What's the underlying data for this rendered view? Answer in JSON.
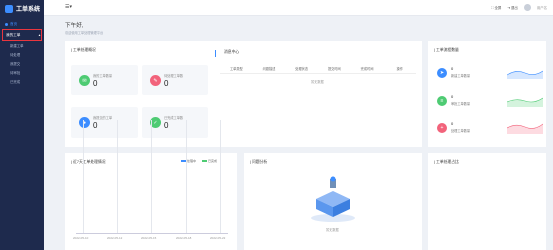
{
  "sidebar": {
    "app_title": "工单系统",
    "home": "首页",
    "group": "我的工单",
    "items": [
      "新建工单",
      "待处理",
      "我提交",
      "待审批",
      "已完成"
    ]
  },
  "topbar": {
    "menu_icon": "menu-icon",
    "fullscreen": "全屏",
    "logout": "退出",
    "user": "用户名"
  },
  "greeting": {
    "title": "下午好,",
    "subtitle": "欢迎使用工单处理管理平台"
  },
  "overview": {
    "title": "工单处理概况",
    "stats": [
      {
        "label": "我的工单数量",
        "value": "0",
        "color": "#4ecb73"
      },
      {
        "label": "待处理工单数",
        "value": "0",
        "color": "#f2637b"
      },
      {
        "label": "我提交的工单",
        "value": "0",
        "color": "#3c8dff"
      },
      {
        "label": "已完成工单数",
        "value": "0",
        "color": "#4ecb73"
      }
    ]
  },
  "messages": {
    "title": "消息中心",
    "columns": [
      "工单类型",
      "问题描述",
      "处理状态",
      "提交时间",
      "完成时间",
      "操作"
    ],
    "empty": "暂无数据"
  },
  "flow": {
    "title": "工单流程数量",
    "items": [
      {
        "value": "0",
        "label": "新建工单数量",
        "color": "#3c8dff"
      },
      {
        "value": "0",
        "label": "审批工单数量",
        "color": "#4ecb73"
      },
      {
        "value": "0",
        "label": "处理工单数量",
        "color": "#f2637b"
      }
    ]
  },
  "trend": {
    "title": "近7天工单处理情况",
    "legend": [
      "处理中",
      "已完成"
    ],
    "legend_colors": [
      "#3c8dff",
      "#4ecb73"
    ],
    "dates": [
      "2022-05-10",
      "2022-05-12",
      "2022-05-15",
      "2022-05-18",
      "2022-05-22"
    ]
  },
  "problems": {
    "title": "问题分析",
    "empty": "暂无数据"
  },
  "rank": {
    "title": "工单处理占比"
  }
}
